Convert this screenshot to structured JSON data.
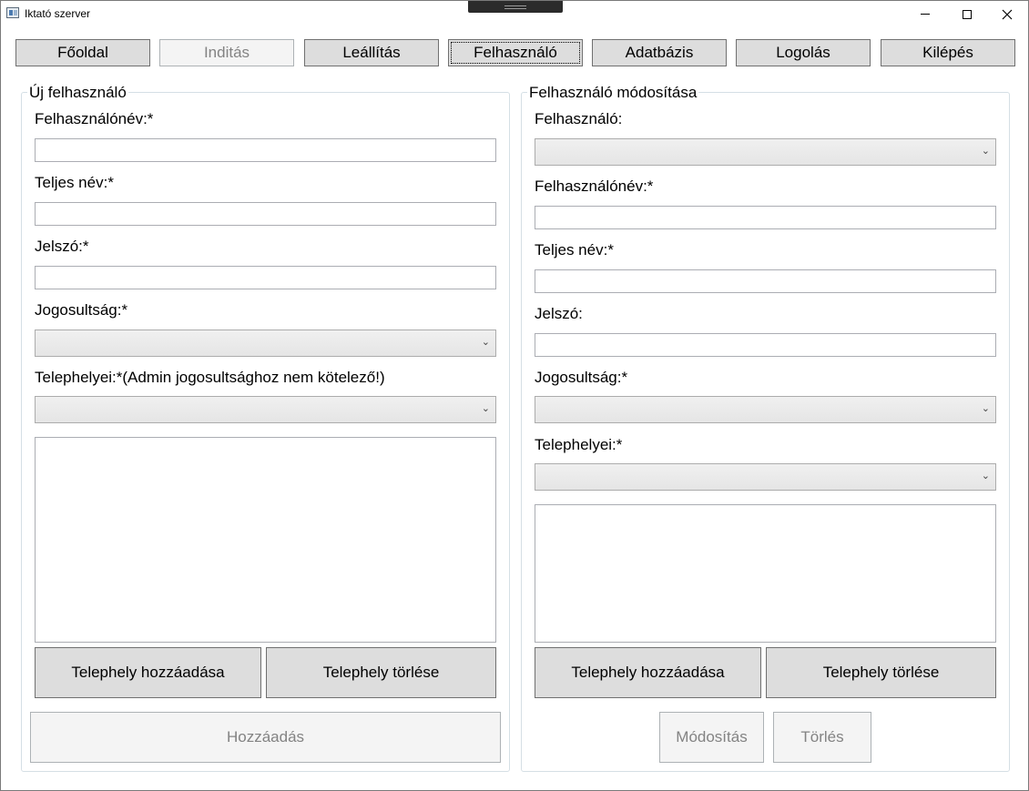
{
  "window": {
    "title": "Iktató szerver"
  },
  "nav": {
    "home": "Főoldal",
    "start": "Inditás",
    "stop": "Leállítás",
    "user": "Felhasználó",
    "database": "Adatbázis",
    "logging": "Logolás",
    "exit": "Kilépés"
  },
  "new_user": {
    "title": "Új felhasználó",
    "username_label": "Felhasználónév:*",
    "username_value": "",
    "fullname_label": "Teljes név:*",
    "fullname_value": "",
    "password_label": "Jelszó:*",
    "password_value": "",
    "permission_label": "Jogosultság:*",
    "permission_value": "",
    "sites_label": "Telephelyei:*(Admin jogosultsághoz nem kötelező!)",
    "sites_value": "",
    "sites_list": [],
    "add_site_button": "Telephely hozzáadása",
    "delete_site_button": "Telephely törlése",
    "add_button": "Hozzáadás"
  },
  "modify_user": {
    "title": "Felhasználó módosítása",
    "user_label": "Felhasználó:",
    "user_value": "",
    "username_label": "Felhasználónév:*",
    "username_value": "",
    "fullname_label": "Teljes név:*",
    "fullname_value": "",
    "password_label": "Jelszó:",
    "password_value": "",
    "permission_label": "Jogosultság:*",
    "permission_value": "",
    "sites_label": "Telephelyei:*",
    "sites_value": "",
    "sites_list": [],
    "add_site_button": "Telephely hozzáadása",
    "delete_site_button": "Telephely törlése",
    "modify_button": "Módosítás",
    "delete_button": "Törlés"
  }
}
